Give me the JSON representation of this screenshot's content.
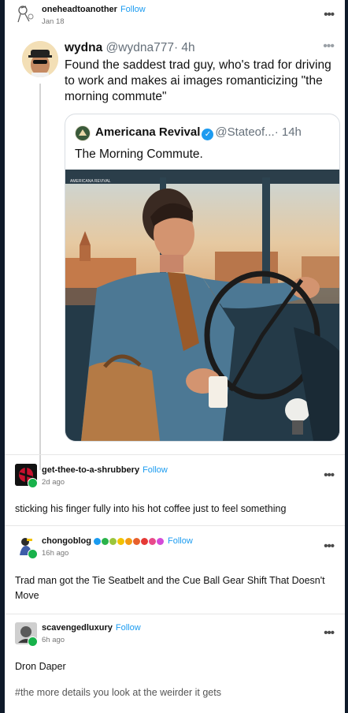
{
  "posts": [
    {
      "author": "oneheadtoanother",
      "follow_label": "Follow",
      "time": "Jan 18",
      "more": "•••",
      "tweet": {
        "name": "wydna",
        "handle": "@wydna777",
        "time": "· 4h",
        "more": "•••",
        "text": "Found the saddest trad guy, who's trad for driving to work and makes ai images romanticizing \"the morning commute\"",
        "quote": {
          "name": "Americana Revival",
          "handle": "@Stateof...",
          "time": "· 14h",
          "text": "The Morning Commute.",
          "image_watermark": "AMERICANA REVIVAL"
        }
      }
    },
    {
      "author": "get-thee-to-a-shrubbery",
      "follow_label": "Follow",
      "time": "2d ago",
      "more": "•••",
      "text": "sticking his finger fully into his hot coffee just to feel something"
    },
    {
      "author": "chongoblog",
      "follow_label": "Follow",
      "time": "16h ago",
      "more": "•••",
      "badge_colors": [
        "#1a9bf0",
        "#2ab34a",
        "#9bc63b",
        "#f2c200",
        "#f39c12",
        "#e8602c",
        "#e53935",
        "#e84a8a",
        "#d34bd8"
      ],
      "text": "Trad man got the Tie Seatbelt and the Cue Ball Gear Shift That Doesn't Move"
    },
    {
      "author": "scavengedluxury",
      "follow_label": "Follow",
      "time": "6h ago",
      "more": "•••",
      "text": "Dron Daper",
      "tags": "#the more details you look at the weirder it gets"
    }
  ],
  "colors": {
    "follow": "#1a9bf0",
    "online_badge": "#18b24b",
    "verified": "#1d9bf0"
  }
}
